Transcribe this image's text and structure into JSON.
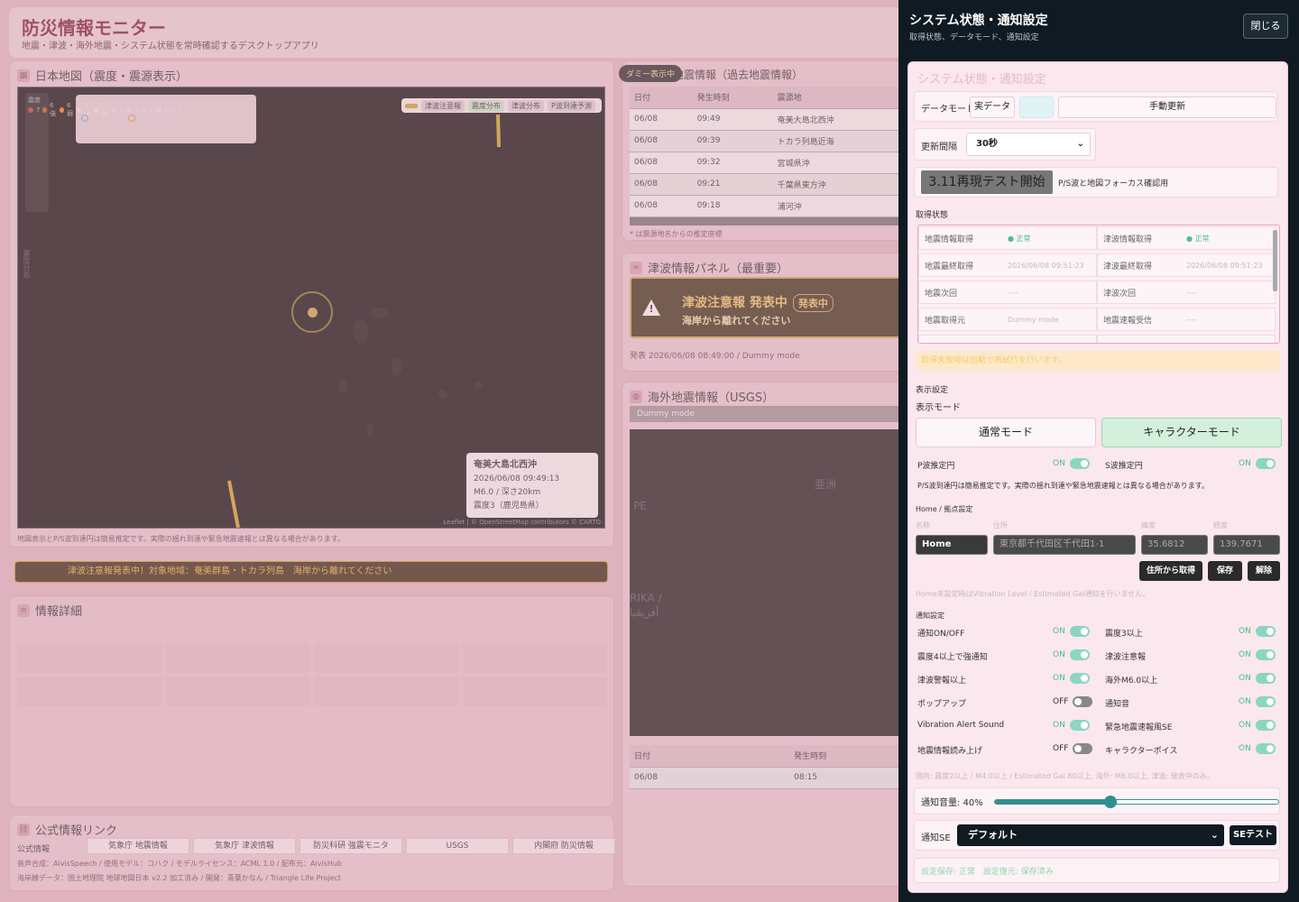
{
  "app": {
    "title": "防災情報モニター",
    "subtitle": "地震・津波・海外地震・システム状態を常時確認するデスクトップアプリ"
  },
  "map_panel": {
    "title": "日本地図（震度・震源表示）",
    "legend_title": "震度",
    "legend": [
      {
        "label": "7",
        "color": "#c0392b"
      },
      {
        "label": "6強",
        "color": "#d35400"
      },
      {
        "label": "6弱",
        "color": "#e67e22"
      },
      {
        "label": "5強",
        "color": "#d4ac0d"
      },
      {
        "label": "5弱",
        "color": "#c9a227"
      },
      {
        "label": "4",
        "color": "#2e8b57"
      },
      {
        "label": "3",
        "color": "#1f7a8c"
      },
      {
        "label": "2",
        "color": "#2c5aa0"
      },
      {
        "label": "1",
        "color": "#7f8c8d"
      },
      {
        "label": "0",
        "color": "#1a3d8f"
      }
    ],
    "layers": [
      "津波注意報",
      "震度分布",
      "津波分布",
      "P波到達予測"
    ],
    "side_label": "震度分布",
    "quake_card": {
      "title": "奄美大島北西沖",
      "time": "2026/06/08 09:49:13",
      "mag_depth": "M6.0 / 深さ20km",
      "intensity": "震度3（鹿児島県）"
    },
    "attribution": "Leaflet | © OpenStreetMap contributors © CARTO",
    "note": "地図表示とP/S波到達円は簡易推定です。実際の揺れ到達や緊急地震速報とは異なる場合があります。"
  },
  "alert_bar": "津波注意報発表中！対象地域：奄美群島・トカラ列島　海岸から離れてください",
  "detail_panel": {
    "title": "情報詳細"
  },
  "links_panel": {
    "title": "公式情報リンク",
    "row_label": "公式情報",
    "links": [
      "気象庁 地震情報",
      "気象庁 津波情報",
      "防災科研 強震モニタ",
      "USGS",
      "内閣府 防災情報"
    ],
    "credit1": "音声合成：AivisSpeech / 使用モデル：コハク / モデルライセンス：ACML 1.0 / 配布元：AivisHub",
    "credit2": "海岸線データ：国土地理院 地球地図日本 v2.2 加工済み / 開発：青葉かなん / Triangle Life Project"
  },
  "eq_panel": {
    "badge": "ダミー表示中",
    "title": "地震情報（過去地震情報）",
    "headers": [
      "日付",
      "発生時刻",
      "震源地"
    ],
    "rows": [
      [
        "06/08",
        "09:49",
        "奄美大島北西沖"
      ],
      [
        "06/08",
        "09:39",
        "トカラ列島近海"
      ],
      [
        "06/08",
        "09:32",
        "宮城県沖"
      ],
      [
        "06/08",
        "09:21",
        "千葉県東方沖"
      ],
      [
        "06/08",
        "09:18",
        "浦河沖"
      ]
    ],
    "note": "* は震源地名からの推定座標"
  },
  "tsunami_panel": {
    "title": "津波情報パネル（最重要）",
    "headline": "津波注意報 発表中",
    "badge": "発表中",
    "message": "海岸から離れてください",
    "issued": "発表 2026/06/08 08:49:00 / Dummy mode"
  },
  "usgs_panel": {
    "title": "海外地震情報（USGS）",
    "mode": "Dummy mode",
    "map_labels": [
      "亜洲",
      "PE",
      "RIKA /",
      "أفريقيا"
    ],
    "headers": [
      "日付",
      "発生時刻"
    ],
    "row": [
      "06/08",
      "08:15"
    ]
  },
  "drawer": {
    "title": "システム状態・通知設定",
    "subtitle": "取得状態、データモード、通知設定",
    "close": "閉じる",
    "card_title": "システム状態・通知設定",
    "data_mode_label": "データモード",
    "data_mode_real": "実データ",
    "manual_refresh": "手動更新",
    "interval_label": "更新間隔",
    "interval_value": "30秒",
    "test_button": "3.11再現テスト開始",
    "test_note": "P/S波と地図フォーカス確認用",
    "status_title": "取得状態",
    "status": [
      [
        "地震情報取得",
        "● 正常",
        "津波情報取得",
        "● 正常"
      ],
      [
        "地震最終取得",
        "2026/06/08 09:51:23",
        "津波最終取得",
        "2026/06/08 09:51:23"
      ],
      [
        "地震次回",
        "----",
        "津波次回",
        "----"
      ],
      [
        "地震取得元",
        "Dummy mode",
        "地震速報受信",
        "----"
      ],
      [
        "津波取得元",
        "Dummy mode",
        "地図表示",
        "ダミー入り"
      ]
    ],
    "status_warn": "取得失敗時は自動で再試行を行います。",
    "display_title": "表示設定",
    "display_mode_label": "表示モード",
    "normal_mode": "通常モード",
    "character_mode": "キャラクターモード",
    "p_circle": "P波推定円",
    "s_circle": "S波推定円",
    "on": "ON",
    "off": "OFF",
    "ps_note": "P/S波到達円は簡易推定です。実際の揺れ到達や緊急地震速報とは異なる場合があります。",
    "home_title": "Home / 拠点設定",
    "home_labels": [
      "名称",
      "住所",
      "緯度",
      "経度"
    ],
    "home_name": "Home",
    "home_address": "東京都千代田区千代田1-1",
    "home_lat": "35.6812",
    "home_lon": "139.7671",
    "home_buttons": [
      "住所から取得",
      "保存",
      "解除"
    ],
    "home_note": "Home未設定時はVibration Level / Estimated Gal通知を行いません。",
    "notify_title": "通知設定",
    "toggles": [
      {
        "label": "通知ON/OFF",
        "state": "ON"
      },
      {
        "label": "震度3以上",
        "state": "ON"
      },
      {
        "label": "震度4以上で強通知",
        "state": "ON"
      },
      {
        "label": "津波注意報",
        "state": "ON"
      },
      {
        "label": "津波警報以上",
        "state": "ON"
      },
      {
        "label": "海外M6.0以上",
        "state": "ON"
      },
      {
        "label": "ポップアップ",
        "state": "OFF"
      },
      {
        "label": "通知音",
        "state": "ON"
      },
      {
        "label": "Vibration Alert Sound",
        "state": "ON"
      },
      {
        "label": "緊急地震速報風SE",
        "state": "ON"
      },
      {
        "label": "地震情報読み上げ",
        "state": "OFF"
      },
      {
        "label": "キャラクターボイス",
        "state": "ON"
      }
    ],
    "notify_note": "国内: 震度2以上 / M4.0以上 / Estimated Gal 80以上, 海外: M6.0以上, 津波: 発表中のみ。",
    "volume_label": "通知音量: 40%",
    "volume": 0.4,
    "se_label": "通知SE",
    "se_value": "デフォルト",
    "se_test": "SEテスト",
    "footer": "設定保存: 正常　設定復元: 保存済み"
  }
}
